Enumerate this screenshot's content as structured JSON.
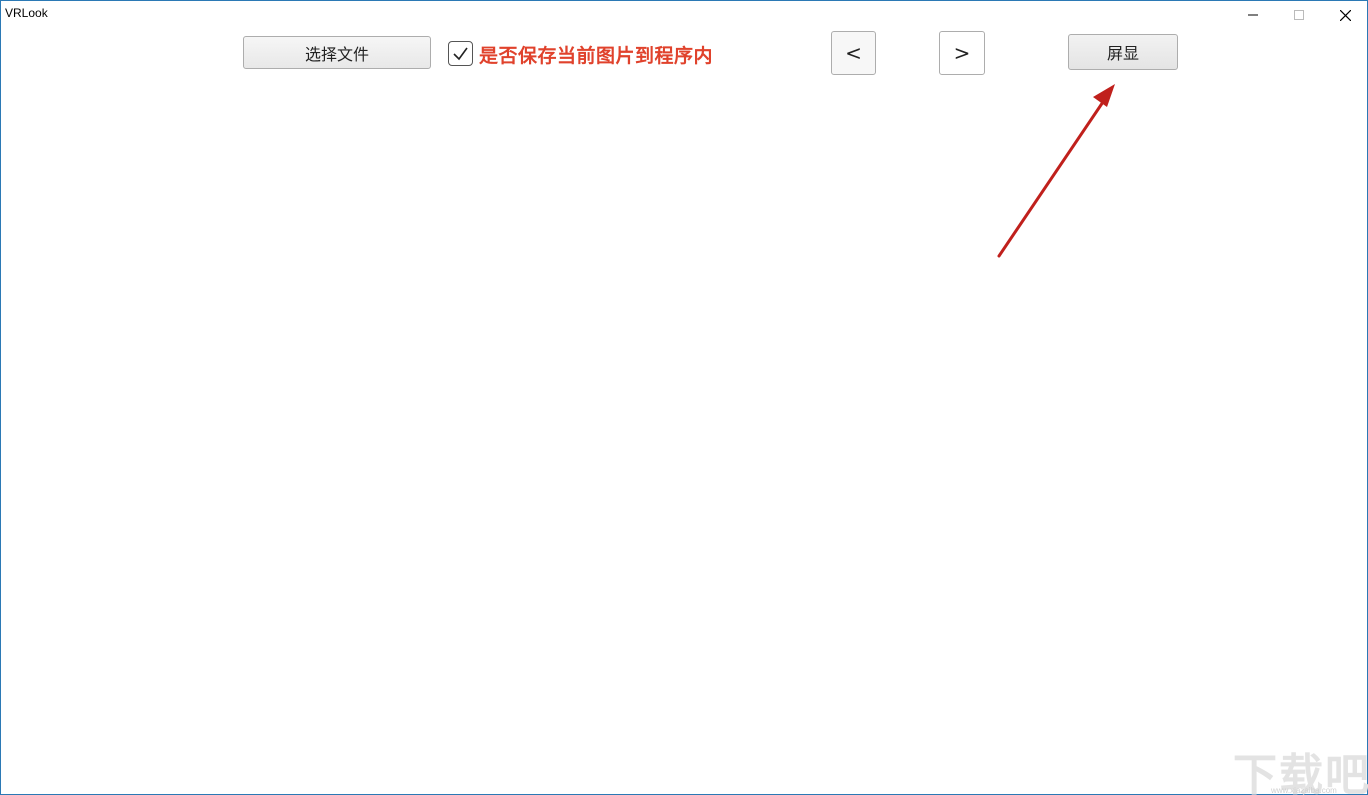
{
  "window": {
    "title": "VRLook"
  },
  "toolbar": {
    "select_file_label": "选择文件",
    "save_checkbox_label": "是否保存当前图片到程序内",
    "save_checkbox_checked": true,
    "prev_label": "<",
    "next_label": ">",
    "screen_label": "屏显"
  },
  "colors": {
    "checkbox_label": "#e0422c",
    "annotation_arrow": "#c0201c",
    "window_border": "#2b79b5"
  },
  "watermark": {
    "text": "下载吧",
    "url": "www.xiazaiba.com"
  }
}
